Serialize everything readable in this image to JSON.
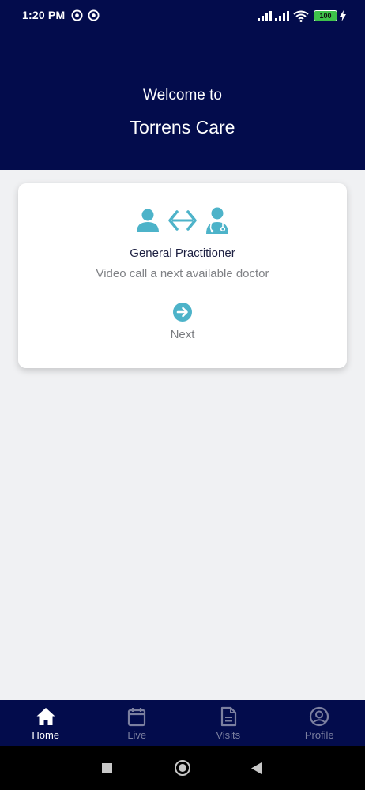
{
  "status_bar": {
    "time": "1:20 PM",
    "battery": "100"
  },
  "header": {
    "welcome": "Welcome to",
    "app_name": "Torrens Care"
  },
  "card": {
    "title": "General Practitioner",
    "subtitle": "Video call a next available doctor",
    "next_label": "Next",
    "icons": [
      "patient-icon",
      "two-way-arrow-icon",
      "doctor-icon",
      "arrow-circle-right-icon"
    ],
    "accent_color": "#4db3c9"
  },
  "bottom_nav": {
    "items": [
      {
        "label": "Home",
        "icon": "home-icon",
        "active": true
      },
      {
        "label": "Live",
        "icon": "calendar-icon",
        "active": false
      },
      {
        "label": "Visits",
        "icon": "document-icon",
        "active": false
      },
      {
        "label": "Profile",
        "icon": "profile-icon",
        "active": false
      }
    ]
  },
  "colors": {
    "header_bg": "#030c4c",
    "page_bg": "#f0f1f3",
    "inactive_nav": "#7c80a0"
  }
}
